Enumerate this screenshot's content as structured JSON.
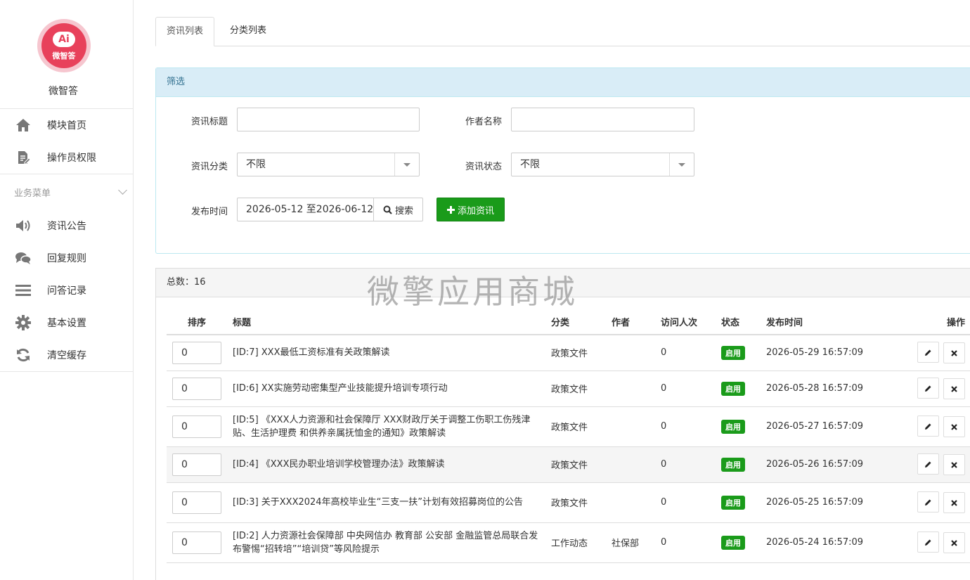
{
  "app": {
    "name": "微智答",
    "logo_ai": "Ai",
    "logo_cn": "微智答"
  },
  "sidebar": {
    "top_items": [
      {
        "label": "模块首页",
        "icon": "home-icon"
      },
      {
        "label": "操作员权限",
        "icon": "edit-document-icon"
      }
    ],
    "group_label": "业务菜单",
    "items": [
      {
        "label": "资讯公告",
        "icon": "speaker-icon"
      },
      {
        "label": "回复规则",
        "icon": "chat-icon"
      },
      {
        "label": "问答记录",
        "icon": "list-icon"
      },
      {
        "label": "基本设置",
        "icon": "gear-icon"
      },
      {
        "label": "清空缓存",
        "icon": "refresh-icon"
      }
    ]
  },
  "tabs": [
    {
      "label": "资讯列表",
      "active": true
    },
    {
      "label": "分类列表",
      "active": false
    }
  ],
  "filter": {
    "heading": "筛选",
    "title_label": "资讯标题",
    "title_value": "",
    "author_label": "作者名称",
    "author_value": "",
    "category_label": "资讯分类",
    "category_value": "不限",
    "status_label": "资讯状态",
    "status_value": "不限",
    "date_label": "发布时间",
    "date_value": "2026-05-12 至2026-06-12  ",
    "search_button": "搜索",
    "add_button": "添加资讯"
  },
  "list": {
    "total_label": "总数：",
    "total": "16",
    "watermark": "微擎应用商城",
    "columns": [
      "排序",
      "标题",
      "分类",
      "作者",
      "访问人次",
      "状态",
      "发布时间",
      "操作"
    ],
    "rows": [
      {
        "sort": "0",
        "title": "[ID:7] XXX最低工资标准有关政策解读",
        "category": "政策文件",
        "author": "",
        "visits": "0",
        "status": "启用",
        "date": "2026-05-29 16:57:09"
      },
      {
        "sort": "0",
        "title": "[ID:6] XX实施劳动密集型产业技能提升培训专项行动",
        "category": "政策文件",
        "author": "",
        "visits": "0",
        "status": "启用",
        "date": "2026-05-28 16:57:09"
      },
      {
        "sort": "0",
        "title": "[ID:5] 《XXX人力资源和社会保障厅 XXX财政厅关于调整工伤职工伤残津贴、生活护理费 和供养亲属抚恤金的通知》政策解读",
        "category": "政策文件",
        "author": "",
        "visits": "0",
        "status": "启用",
        "date": "2026-05-27 16:57:09"
      },
      {
        "sort": "0",
        "title": "[ID:4] 《XXX民办职业培训学校管理办法》政策解读",
        "category": "政策文件",
        "author": "",
        "visits": "0",
        "status": "启用",
        "date": "2026-05-26 16:57:09"
      },
      {
        "sort": "0",
        "title": "[ID:3] 关于XXX2024年高校毕业生“三支一扶”计划有效招募岗位的公告",
        "category": "政策文件",
        "author": "",
        "visits": "0",
        "status": "启用",
        "date": "2026-05-25 16:57:09"
      },
      {
        "sort": "0",
        "title": "[ID:2] 人力资源社会保障部 中央网信办 教育部 公安部 金融监管总局联合发布警惕“招转培”“培训贷”等风险提示",
        "category": "工作动态",
        "author": "社保部",
        "visits": "0",
        "status": "启用",
        "date": "2026-05-24 16:57:09"
      }
    ]
  },
  "colors": {
    "status_green": "#1a9b1a",
    "brand_red": "#e8415b",
    "panel_blue": "#d9edf7"
  }
}
